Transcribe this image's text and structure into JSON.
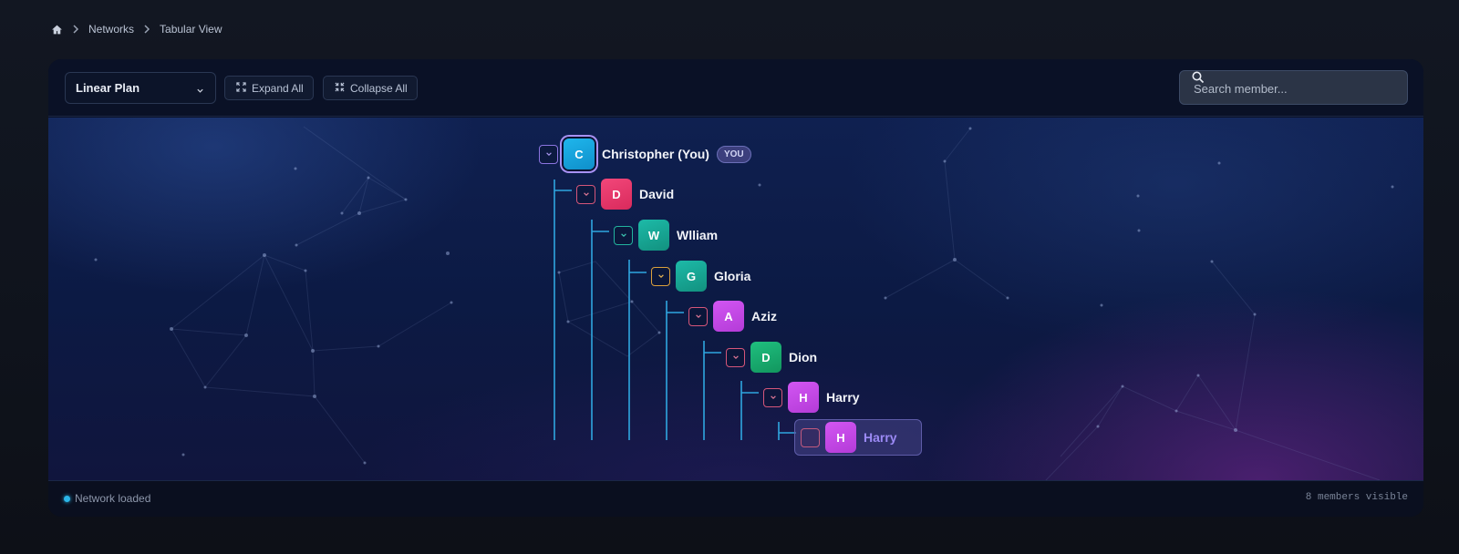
{
  "breadcrumb": {
    "home_icon": "home-icon",
    "items": [
      "Networks",
      "Tabular View"
    ]
  },
  "toolbar": {
    "plan_select": {
      "value": "Linear Plan",
      "icon": "chevron-down-icon"
    },
    "expand_label": "Expand All",
    "expand_icon": "expand-icon",
    "collapse_label": "Collapse All",
    "collapse_icon": "collapse-icon",
    "search": {
      "placeholder": "Search member...",
      "icon": "search-icon"
    }
  },
  "tree": {
    "connector_color": "#2fa6e0",
    "nodes": [
      {
        "initial": "C",
        "name": "Christopher (You)",
        "badge": "YOU",
        "color": "#17a1d9",
        "toggle_color": "#8b74e0",
        "level": 0
      },
      {
        "initial": "D",
        "name": "David",
        "color": "#ea3a6a",
        "toggle_color": "#d5567a",
        "level": 1
      },
      {
        "initial": "W",
        "name": "Wlliam",
        "color": "#17a596",
        "toggle_color": "#22b39e",
        "level": 2
      },
      {
        "initial": "G",
        "name": "Gloria",
        "color": "#17a596",
        "toggle_color": "#dba13c",
        "level": 3
      },
      {
        "initial": "A",
        "name": "Aziz",
        "color": "#c34ae6",
        "toggle_color": "#d5567a",
        "level": 4
      },
      {
        "initial": "D",
        "name": "Dion",
        "color": "#17a86e",
        "toggle_color": "#d5567a",
        "level": 5
      },
      {
        "initial": "H",
        "name": "Harry",
        "color": "#c34ae6",
        "toggle_color": "#d5567a",
        "level": 6
      },
      {
        "initial": "H",
        "name": "Harry",
        "color": "#c34ae6",
        "toggle_color": "#c15a7e",
        "level": 7,
        "selected": true
      }
    ]
  },
  "status": {
    "text": "Network loaded",
    "count_text": "8 members visible"
  }
}
